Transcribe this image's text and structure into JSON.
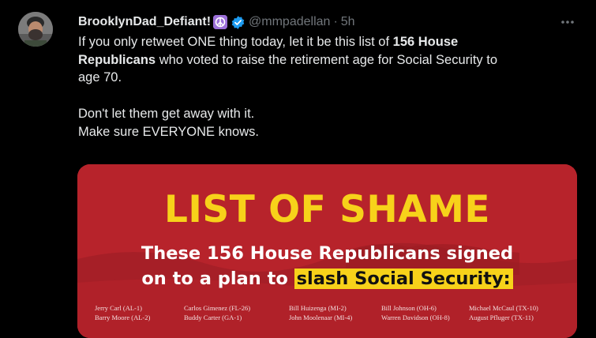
{
  "author": {
    "display_name": "BrooklynDad_Defiant!",
    "handle": "@mmpadellan",
    "time": "5h",
    "separator": "·"
  },
  "tweet": {
    "l1_pre": "If you only retweet ONE thing today, let it be this list of ",
    "l1_bold": "156 House",
    "l2_bold": "Republicans",
    "l2_post": " who voted to raise the retirement age for Social Security to",
    "l3": "age 70.",
    "l4": "Don't let them get away with it.",
    "l5": "Make sure EVERYONE knows."
  },
  "media": {
    "title": "LIST OF SHAME",
    "subtitle_line1": "These 156 House Republicans signed",
    "subtitle_line2_pre": "on to a plan to ",
    "subtitle_highlight": "slash Social Security:",
    "names_row1": [
      "Jerry Carl (AL-1)",
      "Carlos Gimenez (FL-26)",
      "Bill Huizenga (MI-2)",
      "Bill Johnson (OH-6)",
      "Michael McCaul (TX-10)"
    ],
    "names_row2": [
      "Barry Moore (AL-2)",
      "Buddy Carter (GA-1)",
      "John Moolenaar (MI-4)",
      "Warren Davidson (OH-8)",
      "August Pfluger (TX-11)"
    ]
  },
  "colors": {
    "background": "#000000",
    "text": "#e7e9ea",
    "muted": "#71767b",
    "verified": "#1d9bf0",
    "banner_red": "#b8242c",
    "banner_yellow": "#f7d21a"
  },
  "icons": {
    "verified": "verified-badge-icon",
    "emoji": "peace-symbol-icon",
    "more": "more-options-icon"
  }
}
